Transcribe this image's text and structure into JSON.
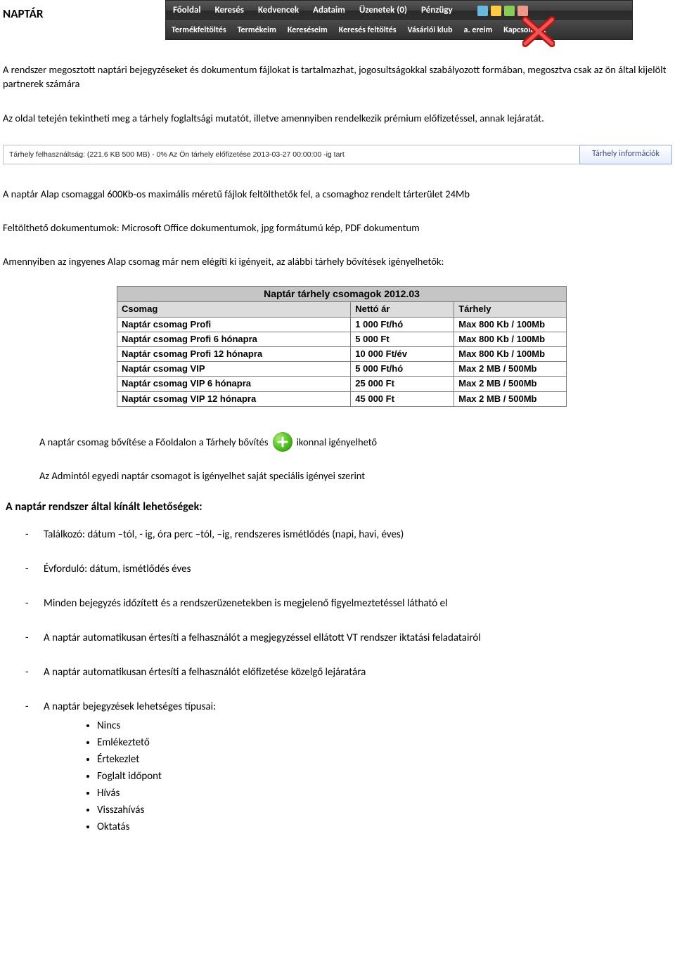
{
  "title": "NAPTÁR",
  "topnav": {
    "items": [
      "Főoldal",
      "Keresés",
      "Kedvencek",
      "Adataim",
      "Üzenetek (0)",
      "Pénzügy"
    ],
    "icon_colors": [
      "#d46",
      "#6bd",
      "#fc4",
      "#8c5",
      "#e98"
    ]
  },
  "subnav": {
    "items": [
      "Termékfeltöltés",
      "Termékeim",
      "Kereséseim",
      "Keresés feltöltés",
      "Vásárlói klub",
      "a.  ereim",
      "Kapcsolatok"
    ]
  },
  "paragraphs": {
    "p1": "A rendszer megosztott naptári bejegyzéseket és dokumentum fájlokat is tartalmazhat, jogosultságokkal szabályozott formában, megosztva csak az ön által kijelölt partnerek számára",
    "p2": "Az oldal tetején tekintheti meg a tárhely foglaltsági mutatót, illetve amennyiben rendelkezik prémium előfizetéssel, annak lejáratát.",
    "p3": "A naptár Alap csomaggal 600Kb-os maximális méretű fájlok feltölthetők fel, a csomaghoz rendelt tárterület 24Mb",
    "p4": "Feltölthető dokumentumok: Microsoft Office dokumentumok, jpg formátumú kép, PDF dokumentum",
    "p5": "Amennyiben az ingyenes Alap csomag már nem elégíti ki igényeit, az alábbi tárhely bővítések igényelhetők:"
  },
  "status_bar": {
    "text": "Tárhely felhasználtság: (221.6 KB 500 MB) - 0% Az Ön tárhely előfizetése 2013-03-27 00:00:00 -ig tart",
    "pill": "Tárhely információk"
  },
  "packages": {
    "title": "Naptár tárhely csomagok 2012.03",
    "columns": [
      "Csomag",
      "Nettó ár",
      "Tárhely"
    ],
    "rows": [
      {
        "name": "Naptár csomag Profi",
        "price": "1 000 Ft/hó",
        "storage": "Max 800 Kb / 100Mb"
      },
      {
        "name": "Naptár csomag Profi 6 hónapra",
        "price": "5 000 Ft",
        "storage": "Max 800 Kb / 100Mb"
      },
      {
        "name": "Naptár csomag Profi 12 hónapra",
        "price": "10 000 Ft/év",
        "storage": "Max 800 Kb / 100Mb"
      },
      {
        "name": "Naptár csomag VIP",
        "price": "5 000 Ft/hó",
        "storage": "Max 2 MB / 500Mb"
      },
      {
        "name": "Naptár csomag VIP 6 hónapra",
        "price": "25 000 Ft",
        "storage": "Max 2 MB / 500Mb"
      },
      {
        "name": "Naptár csomag VIP 12 hónapra",
        "price": "45 000 Ft",
        "storage": "Max 2 MB / 500Mb"
      }
    ]
  },
  "indent": {
    "line1a": "A naptár csomag bővítése a Főoldalon a Tárhely bővítés ",
    "line1b": " ikonnal igényelhető",
    "line2": "Az Admintól egyedi naptár csomagot is igényelhet saját speciális igényei szerint"
  },
  "subheading": "A naptár rendszer által kínált lehetőségek:",
  "features": [
    "Találkozó: dátum –tól, - ig, óra perc –tól, –ig, rendszeres ismétlődés (napi, havi, éves)",
    "Évforduló: dátum, ismétlődés éves",
    "Minden bejegyzés időzített és a rendszerüzenetekben is megjelenő figyelmeztetéssel látható el",
    "A naptár automatikusan értesíti a felhasználót a megjegyzéssel ellátott VT rendszer iktatási feladatairól",
    "A naptár automatikusan értesíti a felhasználót előfizetése közelgő lejáratára"
  ],
  "types_intro": "A naptár bejegyzések lehetséges típusai:",
  "types": [
    "Nincs",
    "Emlékeztető",
    "Értekezlet",
    "Foglalt időpont",
    "Hívás",
    "Visszahívás",
    "Oktatás"
  ]
}
